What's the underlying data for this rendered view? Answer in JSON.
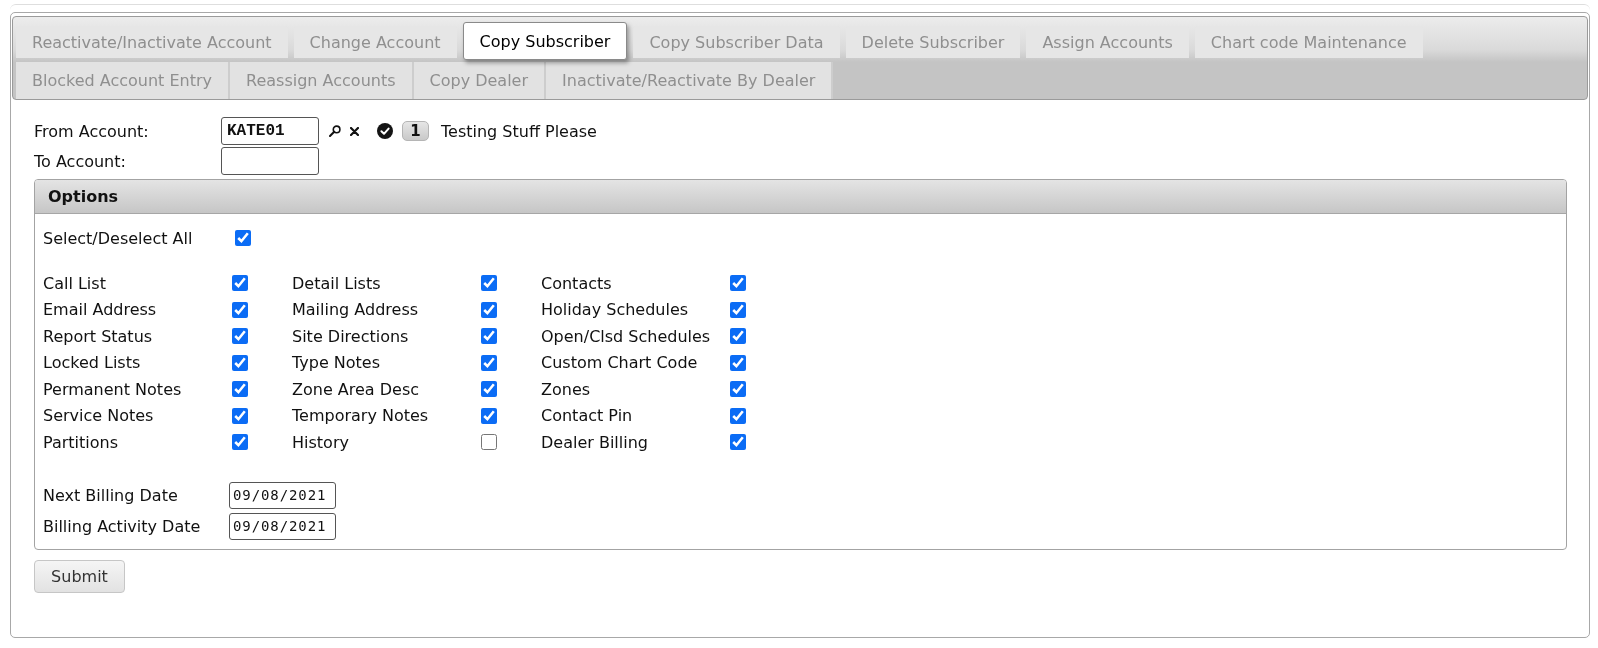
{
  "tab_rows": [
    {
      "tabs": [
        {
          "label": "Reactivate/Inactivate Account",
          "selected": false
        },
        {
          "label": "Change Account",
          "selected": false
        },
        {
          "label": "Copy Subscriber",
          "selected": true
        },
        {
          "label": "Copy Subscriber Data",
          "selected": false
        },
        {
          "label": "Delete Subscriber",
          "selected": false
        },
        {
          "label": "Assign Accounts",
          "selected": false
        },
        {
          "label": "Chart code Maintenance",
          "selected": false
        }
      ]
    },
    {
      "tabs": [
        {
          "label": "Blocked Account Entry",
          "selected": false
        },
        {
          "label": "Reassign Accounts",
          "selected": false
        },
        {
          "label": "Copy Dealer",
          "selected": false
        },
        {
          "label": "Inactivate/Reactivate By Dealer",
          "selected": false
        }
      ]
    }
  ],
  "from_account": {
    "label": "From Account:",
    "value": "KATE01",
    "status_badge": "1",
    "account_name": "Testing Stuff Please"
  },
  "to_account": {
    "label": "To Account:"
  },
  "options": {
    "title": "Options",
    "select_all": {
      "label": "Select/Deselect All",
      "checked": true
    },
    "items": [
      {
        "label": "Call List",
        "checked": true
      },
      {
        "label": "Detail Lists",
        "checked": true
      },
      {
        "label": "Contacts",
        "checked": true
      },
      {
        "label": "Email Address",
        "checked": true
      },
      {
        "label": "Mailing Address",
        "checked": true
      },
      {
        "label": "Holiday Schedules",
        "checked": true
      },
      {
        "label": "Report Status",
        "checked": true
      },
      {
        "label": "Site Directions",
        "checked": true
      },
      {
        "label": "Open/Clsd Schedules",
        "checked": true
      },
      {
        "label": "Locked Lists",
        "checked": true
      },
      {
        "label": "Type Notes",
        "checked": true
      },
      {
        "label": "Custom Chart Code",
        "checked": true
      },
      {
        "label": "Permanent Notes",
        "checked": true
      },
      {
        "label": "Zone Area Desc",
        "checked": true
      },
      {
        "label": "Zones",
        "checked": true
      },
      {
        "label": "Service Notes",
        "checked": true
      },
      {
        "label": "Temporary Notes",
        "checked": true
      },
      {
        "label": "Contact Pin",
        "checked": true
      },
      {
        "label": "Partitions",
        "checked": true
      },
      {
        "label": "History",
        "checked": false
      },
      {
        "label": "Dealer Billing",
        "checked": true
      }
    ],
    "dates": [
      {
        "label": "Next Billing Date",
        "value": "09/08/2021"
      },
      {
        "label": "Billing Activity Date",
        "value": "09/08/2021"
      }
    ]
  },
  "submit_button": {
    "label": "Submit"
  }
}
